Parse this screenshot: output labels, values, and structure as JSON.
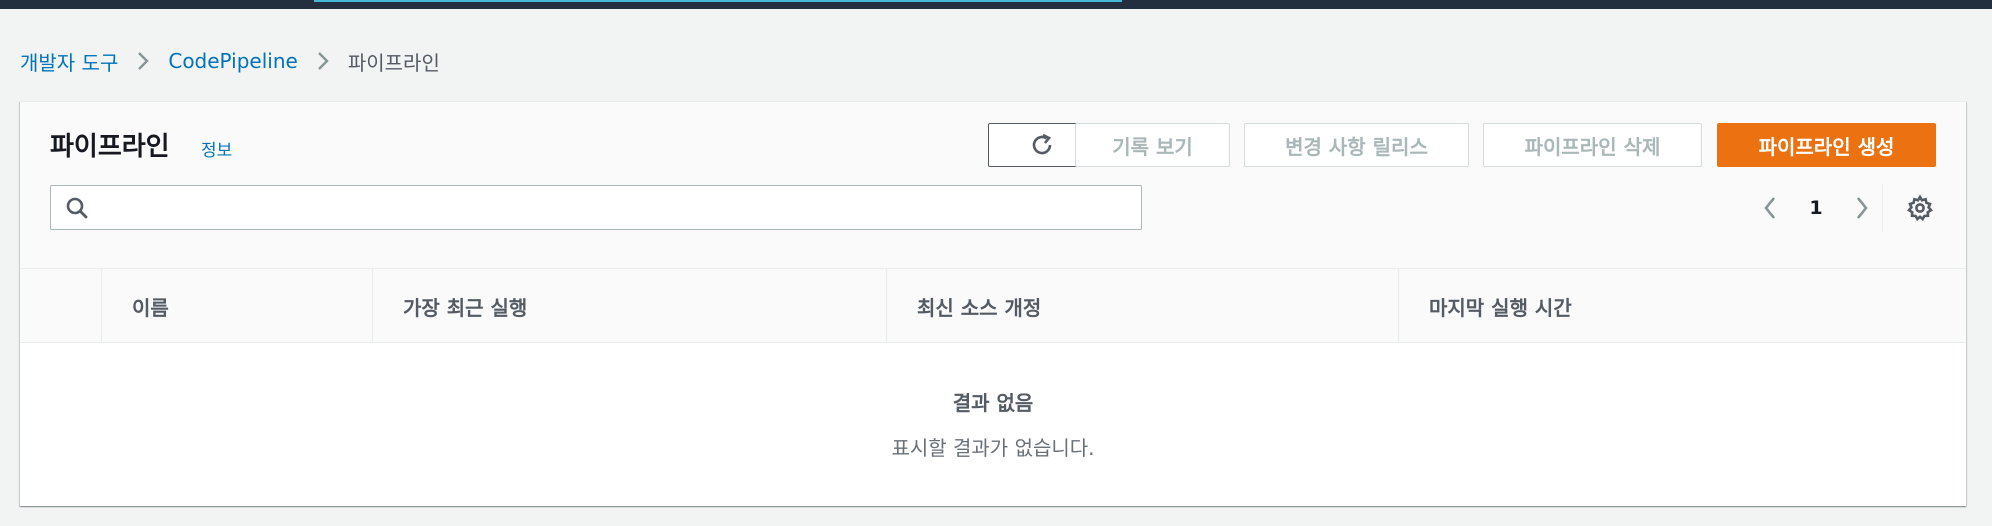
{
  "breadcrumb": {
    "items": [
      "개발자 도구",
      "CodePipeline"
    ],
    "current": "파이프라인"
  },
  "panel": {
    "title": "파이프라인",
    "info": "정보"
  },
  "actions": {
    "refresh_icon": "refresh-icon",
    "history": "기록 보기",
    "release": "변경 사항 릴리스",
    "delete": "파이프라인 삭제",
    "create": "파이프라인 생성"
  },
  "search": {
    "value": "",
    "placeholder": "",
    "icon": "search-icon"
  },
  "pagination": {
    "current": "1"
  },
  "table": {
    "columns": [
      "이름",
      "가장 최근 실행",
      "최신 소스 개정",
      "마지막 실행 시간"
    ],
    "empty_title": "결과 없음",
    "empty_description": "표시할 결과가 없습니다."
  },
  "colors": {
    "topbar": "#232f3e",
    "link": "#0073bb",
    "primary": "#ec7211",
    "disabled_text": "#aab7b8"
  }
}
